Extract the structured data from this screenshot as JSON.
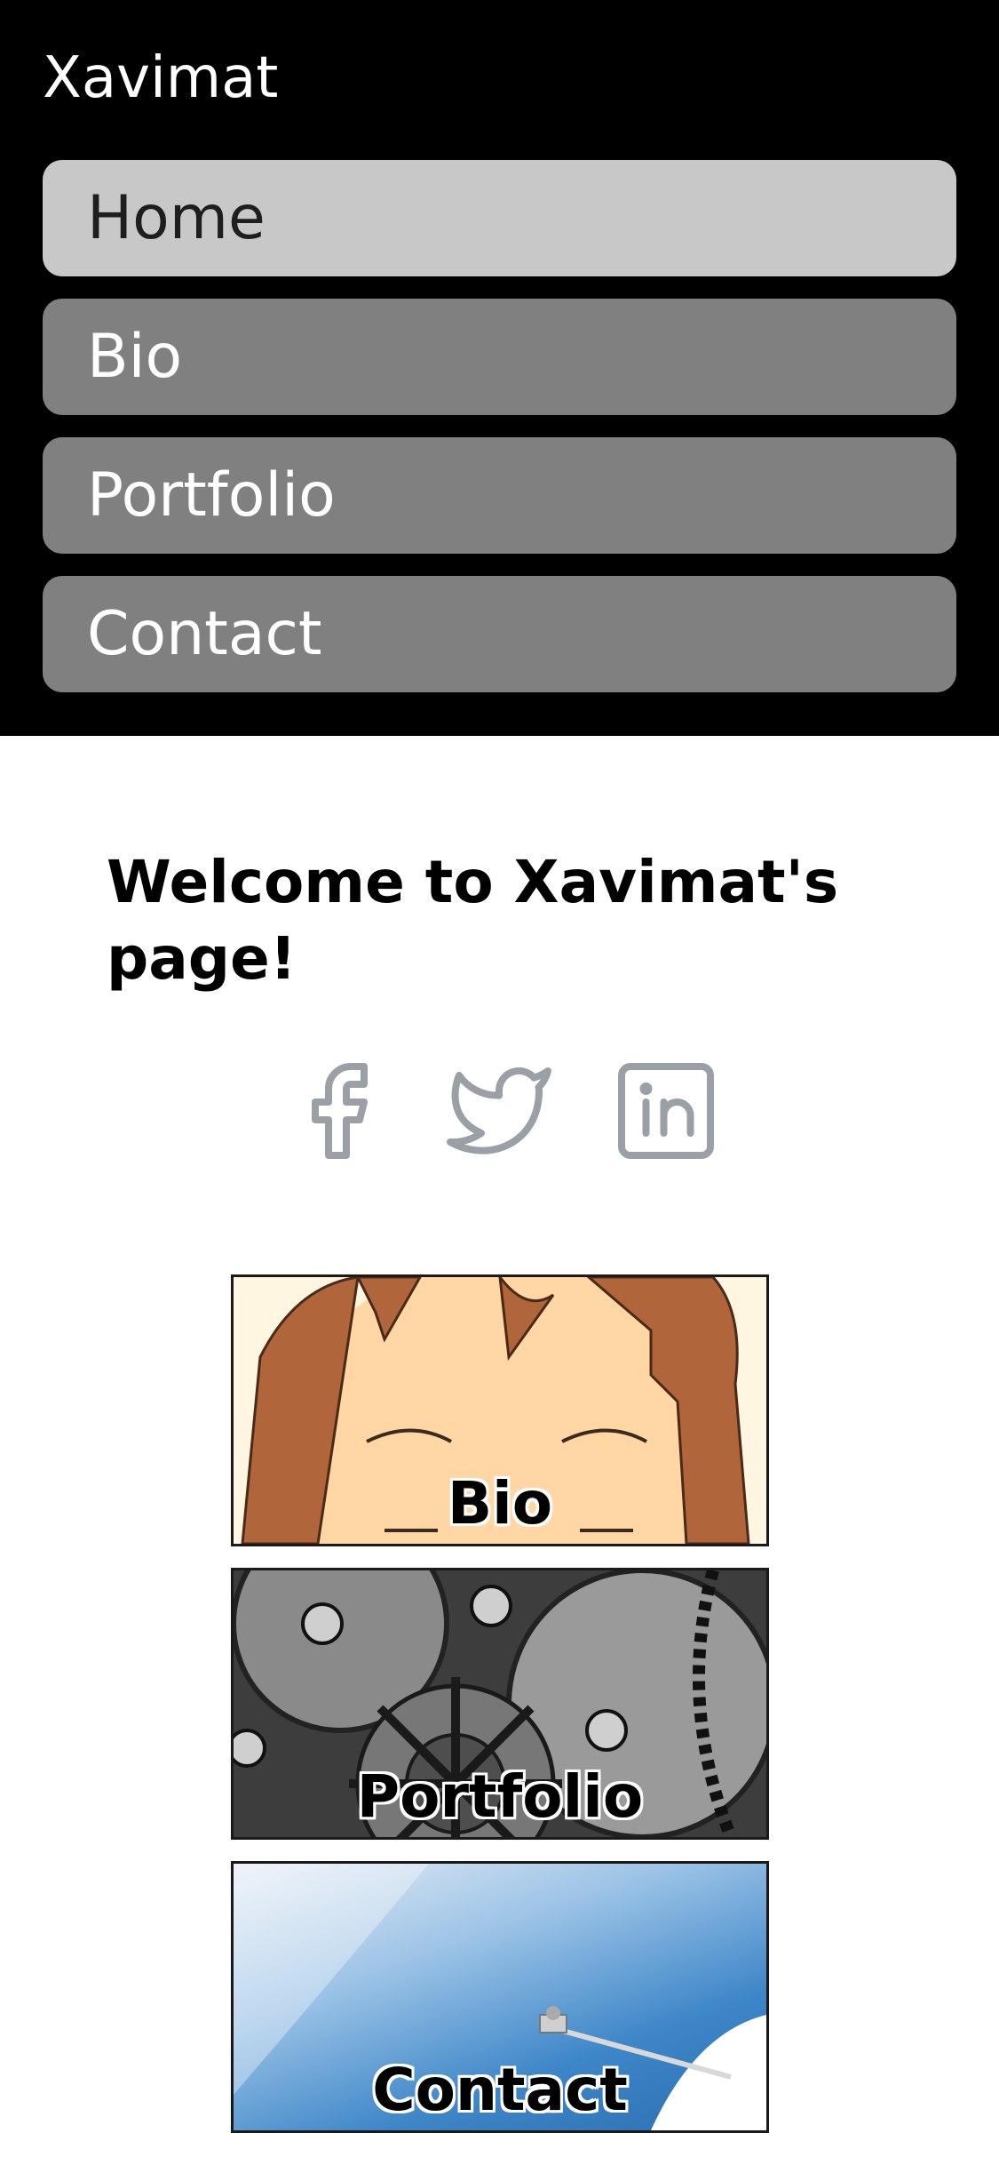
{
  "header": {
    "site_title": "Xavimat",
    "background": "#000000"
  },
  "nav": {
    "items": [
      {
        "label": "Home",
        "active": true
      },
      {
        "label": "Bio",
        "active": false
      },
      {
        "label": "Portfolio",
        "active": false
      },
      {
        "label": "Contact",
        "active": false
      }
    ],
    "active_color": "#c8c8c8",
    "inactive_color": "#808080"
  },
  "main": {
    "welcome": "Welcome to Xavimat's page!",
    "social": [
      {
        "icon": "facebook-icon"
      },
      {
        "icon": "twitter-icon"
      },
      {
        "icon": "linkedin-icon"
      }
    ],
    "social_color": "#9aa0a6",
    "tiles": [
      {
        "label": "Bio",
        "image": "cartoon-face"
      },
      {
        "label": "Portfolio",
        "image": "metal-gears"
      },
      {
        "label": "Contact",
        "image": "sky-satellite-dish"
      }
    ]
  }
}
